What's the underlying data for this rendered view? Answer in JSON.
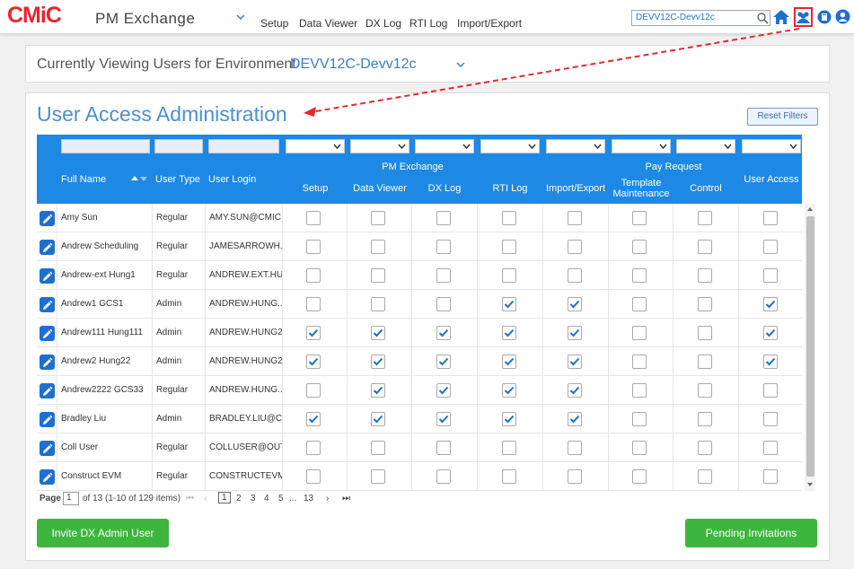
{
  "brand": {
    "logo": "CMiC",
    "app_name": "PM Exchange"
  },
  "nav": [
    "Setup",
    "Data Viewer",
    "DX Log",
    "RTI Log",
    "Import/Export"
  ],
  "env_search": {
    "value": "DEVV12C-Devv12c"
  },
  "env_panel": {
    "label": "Currently Viewing Users for Environment",
    "value": "DEVV12C-Devv12c"
  },
  "page": {
    "title": "User Access Administration",
    "reset_filters": "Reset Filters"
  },
  "columns": {
    "full_name": "Full Name",
    "user_type": "User Type",
    "user_login": "User Login",
    "group_pm": "PM Exchange",
    "group_pay": "Pay Request",
    "setup": "Setup",
    "data_viewer": "Data Viewer",
    "dx_log": "DX Log",
    "rti_log": "RTI Log",
    "import_export": "Import/Export",
    "template_maintenance_1": "Template",
    "template_maintenance_2": "Maintenance",
    "control": "Control",
    "user_access": "User Access"
  },
  "rows": [
    {
      "name": "Amy Sun",
      "type": "Regular",
      "login": "AMY.SUN@CMIC....",
      "checks": [
        0,
        0,
        0,
        0,
        0,
        0,
        0,
        0
      ]
    },
    {
      "name": "Andrew Scheduling",
      "type": "Regular",
      "login": "JAMESARROWH...",
      "checks": [
        0,
        0,
        0,
        0,
        0,
        0,
        0,
        0
      ]
    },
    {
      "name": "Andrew-ext Hung1",
      "type": "Regular",
      "login": "ANDREW.EXT.HU...",
      "checks": [
        0,
        0,
        0,
        0,
        0,
        0,
        0,
        0
      ]
    },
    {
      "name": "Andrew1 GCS1",
      "type": "Admin",
      "login": "ANDREW.HUNG...",
      "checks": [
        0,
        0,
        0,
        1,
        1,
        0,
        0,
        1
      ]
    },
    {
      "name": "Andrew111 Hung111",
      "type": "Admin",
      "login": "ANDREW.HUNG2...",
      "checks": [
        1,
        1,
        1,
        1,
        1,
        0,
        0,
        1
      ]
    },
    {
      "name": "Andrew2 Hung22",
      "type": "Admin",
      "login": "ANDREW.HUNG2...",
      "checks": [
        1,
        1,
        1,
        1,
        1,
        0,
        0,
        1
      ]
    },
    {
      "name": "Andrew2222 GCS33",
      "type": "Regular",
      "login": "ANDREW.HUNG...",
      "checks": [
        0,
        1,
        1,
        1,
        1,
        0,
        0,
        0
      ]
    },
    {
      "name": "Bradley Liu",
      "type": "Admin",
      "login": "BRADLEY.LIU@C...",
      "checks": [
        1,
        1,
        1,
        1,
        1,
        0,
        0,
        0
      ]
    },
    {
      "name": "Coll User",
      "type": "Regular",
      "login": "COLLUSER@OUT...",
      "checks": [
        0,
        0,
        0,
        0,
        0,
        0,
        0,
        0
      ]
    },
    {
      "name": "Construct EVM",
      "type": "Regular",
      "login": "CONSTRUCTEVM...",
      "checks": [
        0,
        0,
        0,
        0,
        0,
        0,
        0,
        0
      ]
    }
  ],
  "pager": {
    "label": "Page",
    "current": "1",
    "summary": "of 13 (1-10 of 129 items)",
    "pages": [
      "1",
      "2",
      "3",
      "4",
      "5",
      "...",
      "13"
    ]
  },
  "buttons": {
    "invite": "Invite DX Admin User",
    "pending": "Pending Invitations"
  },
  "colors": {
    "accent": "#1e88e5",
    "green": "#3db63d",
    "red": "#e8262d"
  }
}
